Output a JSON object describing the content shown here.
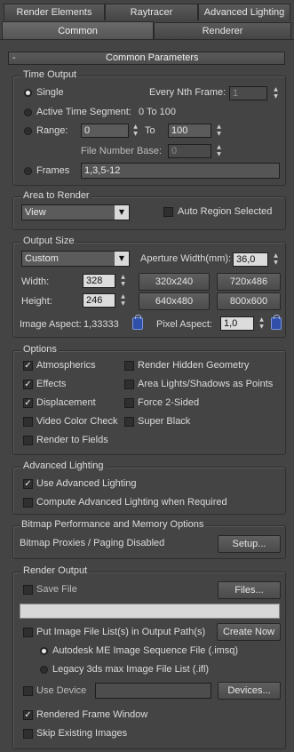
{
  "tabs": {
    "row1": [
      "Render Elements",
      "Raytracer",
      "Advanced Lighting"
    ],
    "row2": [
      "Common",
      "Renderer"
    ]
  },
  "rollout": {
    "toggle": "-",
    "title": "Common Parameters"
  },
  "time_output": {
    "title": "Time Output",
    "single": "Single",
    "nth_frame_label": "Every Nth Frame:",
    "nth_frame_value": "1",
    "active_segment": "Active Time Segment:",
    "active_segment_value": "0 To 100",
    "range": "Range:",
    "range_from": "0",
    "range_to_label": "To",
    "range_to": "100",
    "file_number_base_label": "File Number Base:",
    "file_number_base": "0",
    "frames": "Frames",
    "frames_value": "1,3,5-12"
  },
  "area_to_render": {
    "title": "Area to Render",
    "selected": "View",
    "auto_region": "Auto Region Selected"
  },
  "output_size": {
    "title": "Output Size",
    "preset": "Custom",
    "aperture_label": "Aperture Width(mm):",
    "aperture_value": "36,0",
    "width_label": "Width:",
    "width_value": "328",
    "height_label": "Height:",
    "height_value": "246",
    "presets": [
      "320x240",
      "720x486",
      "640x480",
      "800x600"
    ],
    "image_aspect_label": "Image Aspect:",
    "image_aspect_value": "1,33333",
    "pixel_aspect_label": "Pixel Aspect:",
    "pixel_aspect_value": "1,0"
  },
  "options": {
    "title": "Options",
    "left": [
      {
        "label": "Atmospherics",
        "checked": true
      },
      {
        "label": "Effects",
        "checked": true
      },
      {
        "label": "Displacement",
        "checked": true
      },
      {
        "label": "Video Color Check",
        "checked": false
      },
      {
        "label": "Render to Fields",
        "checked": false
      }
    ],
    "right": [
      {
        "label": "Render Hidden Geometry",
        "checked": false
      },
      {
        "label": "Area Lights/Shadows as Points",
        "checked": false
      },
      {
        "label": "Force 2-Sided",
        "checked": false
      },
      {
        "label": "Super Black",
        "checked": false
      }
    ]
  },
  "advanced_lighting": {
    "title": "Advanced Lighting",
    "use": "Use Advanced Lighting",
    "compute": "Compute Advanced Lighting when Required"
  },
  "bitmap": {
    "title": "Bitmap Performance and Memory Options",
    "status": "Bitmap Proxies / Paging Disabled",
    "setup": "Setup..."
  },
  "render_output": {
    "title": "Render Output",
    "save_file": "Save File",
    "files_button": "Files...",
    "put_list": "Put Image File List(s) in Output Path(s)",
    "create_now": "Create Now",
    "autodesk_option": "Autodesk ME Image Sequence File (.imsq)",
    "legacy_option": "Legacy 3ds max Image File List (.ifl)",
    "use_device": "Use Device",
    "devices_button": "Devices...",
    "rendered_frame_window": "Rendered Frame Window",
    "skip_existing": "Skip Existing Images"
  }
}
